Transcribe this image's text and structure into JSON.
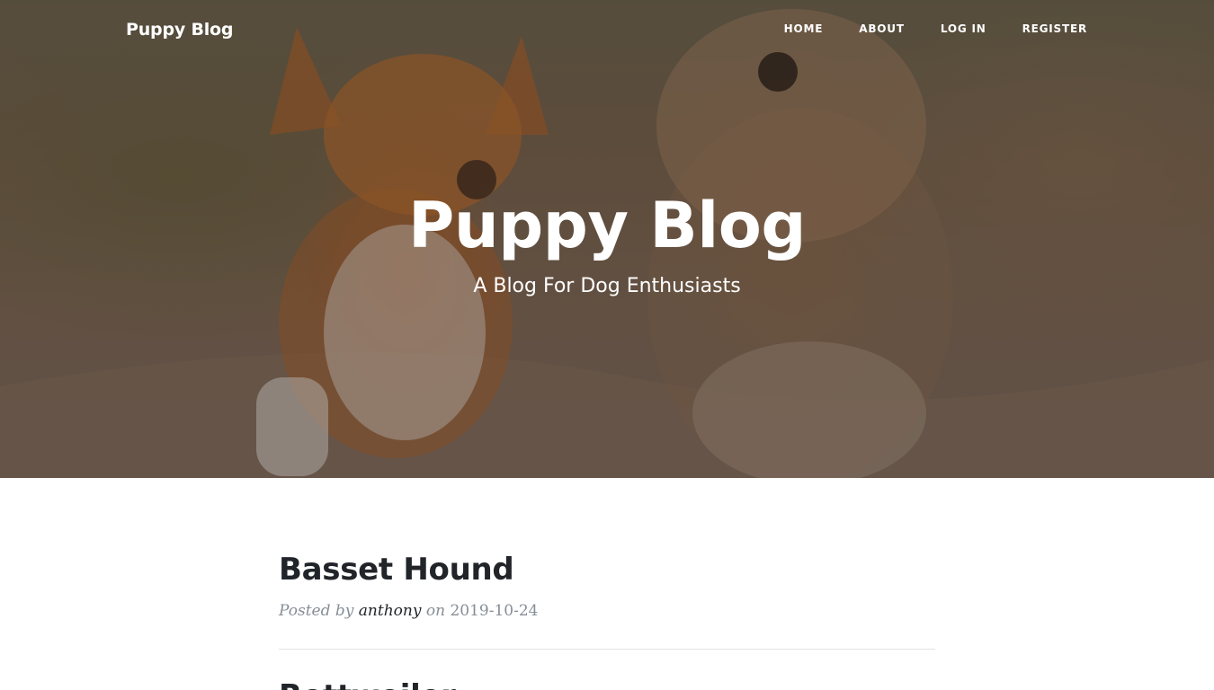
{
  "navbar": {
    "brand": "Puppy Blog",
    "links": [
      {
        "label": "HOME"
      },
      {
        "label": "ABOUT"
      },
      {
        "label": "LOG IN"
      },
      {
        "label": "REGISTER"
      }
    ]
  },
  "hero": {
    "title": "Puppy Blog",
    "subtitle": "A Blog For Dog Enthusiasts"
  },
  "posts": [
    {
      "title": "Basset Hound",
      "posted_by_label": "Posted by",
      "author": "anthony",
      "on_label": "on",
      "date": "2019-10-24"
    },
    {
      "title": "Rottweiler"
    }
  ],
  "colors": {
    "text_dark": "#212529",
    "meta_gray": "#868e96",
    "divider": "#e3e3e3",
    "hero_text": "#ffffff"
  }
}
